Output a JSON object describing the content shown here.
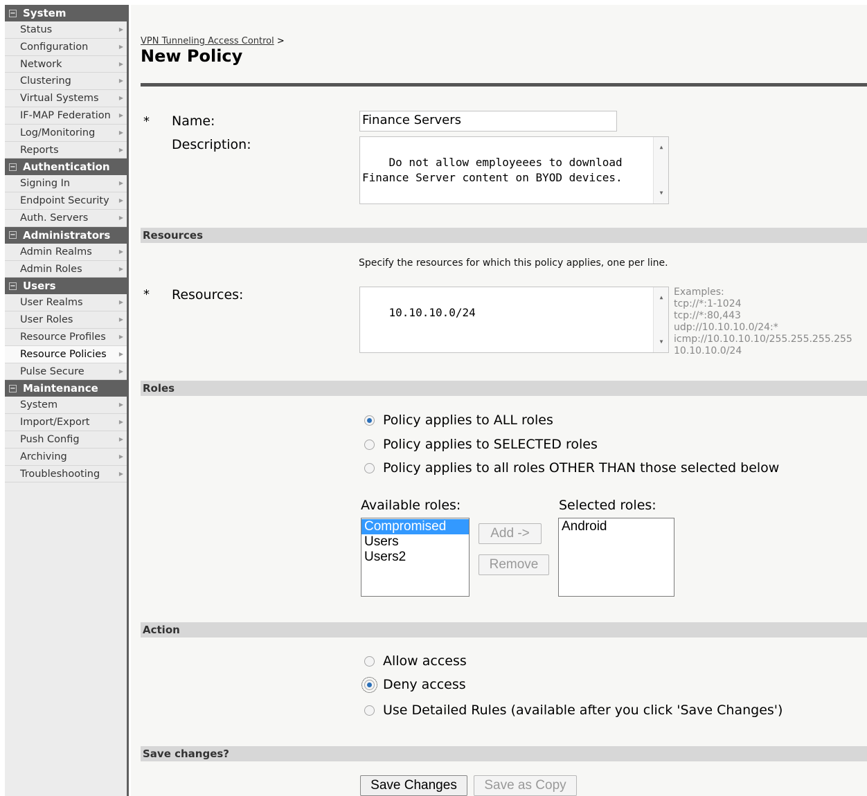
{
  "sidebar": {
    "sections": [
      {
        "title": "System",
        "items": [
          "Status",
          "Configuration",
          "Network",
          "Clustering",
          "Virtual Systems",
          "IF-MAP Federation",
          "Log/Monitoring",
          "Reports"
        ]
      },
      {
        "title": "Authentication",
        "items": [
          "Signing In",
          "Endpoint Security",
          "Auth. Servers"
        ]
      },
      {
        "title": "Administrators",
        "items": [
          "Admin Realms",
          "Admin Roles"
        ]
      },
      {
        "title": "Users",
        "items": [
          "User Realms",
          "User Roles",
          "Resource Profiles",
          "Resource Policies",
          "Pulse Secure"
        ]
      },
      {
        "title": "Maintenance",
        "items": [
          "System",
          "Import/Export",
          "Push Config",
          "Archiving",
          "Troubleshooting"
        ]
      }
    ],
    "selected_item": "Resource Policies"
  },
  "header": {
    "breadcrumb_link": "VPN Tunneling Access Control",
    "breadcrumb_sep": ">",
    "title": "New Policy"
  },
  "form": {
    "required_mark": "*",
    "name_label": "Name:",
    "name_value": "Finance Servers",
    "description_label": "Description:",
    "description_value": "Do not allow employeees to download Finance Server content on BYOD devices.",
    "resources_section": "Resources",
    "resources_help": "Specify the resources for which this policy applies, one per line.",
    "resources_label": "Resources:",
    "resources_value": "10.10.10.0/24",
    "examples": [
      "Examples:",
      "tcp://*:1-1024",
      "tcp://*:80,443",
      "udp://10.10.10.0/24:*",
      "icmp://10.10.10.10/255.255.255.255",
      "10.10.10.0/24"
    ],
    "roles_section": "Roles",
    "role_options": [
      {
        "label": "Policy applies to ALL roles",
        "checked": true
      },
      {
        "label": "Policy applies to SELECTED roles",
        "checked": false
      },
      {
        "label": "Policy applies to all roles OTHER THAN those selected below",
        "checked": false
      }
    ],
    "available_roles_label": "Available roles:",
    "available_roles": [
      "Compromised",
      "Users",
      "Users2"
    ],
    "available_selected": "Compromised",
    "add_button": "Add ->",
    "remove_button": "Remove",
    "selected_roles_label": "Selected roles:",
    "selected_roles": [
      "Android"
    ],
    "action_section": "Action",
    "action_options": [
      {
        "label": "Allow access",
        "checked": false
      },
      {
        "label": "Deny access",
        "checked": true
      },
      {
        "label": "Use Detailed Rules (available after you click 'Save Changes')",
        "checked": false
      }
    ],
    "save_section": "Save changes?",
    "save_button": "Save Changes",
    "save_copy_button": "Save as Copy"
  },
  "colors": {
    "sidebar_header": "#606060",
    "sidebar_bg": "#ececec",
    "section_bar": "#d7d7d7",
    "radio_fill": "#2a6fb8",
    "listbox_selected": "#3399ff"
  }
}
